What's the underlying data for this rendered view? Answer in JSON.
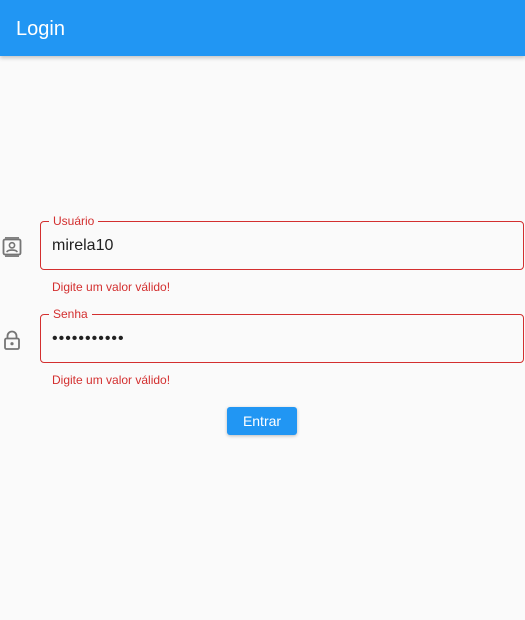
{
  "app_bar": {
    "title": "Login",
    "color": "#2196f3"
  },
  "form": {
    "username": {
      "icon": "contact-icon",
      "label": "Usuário",
      "value": "mirela10",
      "error": "Digite um valor válido!"
    },
    "password": {
      "icon": "lock-icon",
      "label": "Senha",
      "value": "•••••••••••",
      "error": "Digite um valor válido!"
    },
    "submit_label": "Entrar"
  },
  "colors": {
    "error": "#d32f2f",
    "accent": "#2196f3",
    "background": "#fafafa"
  }
}
